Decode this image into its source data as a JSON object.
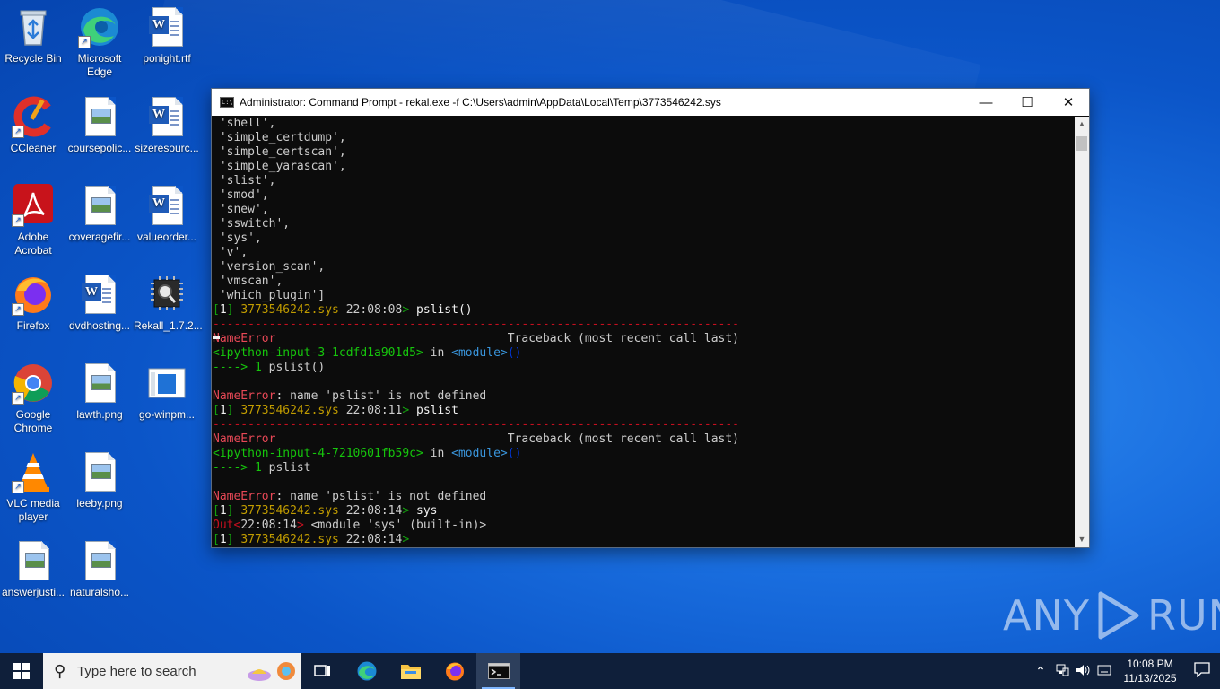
{
  "desktop": {
    "icons": [
      {
        "label": "Recycle Bin",
        "icon": "recycle-bin-icon"
      },
      {
        "label": "Microsoft Edge",
        "icon": "edge-icon"
      },
      {
        "label": "ponight.rtf",
        "icon": "word-document-icon"
      },
      {
        "label": "CCleaner",
        "icon": "ccleaner-icon"
      },
      {
        "label": "coursepolic...",
        "icon": "image-file-icon"
      },
      {
        "label": "sizeresourc...",
        "icon": "word-document-icon"
      },
      {
        "label": "Adobe Acrobat",
        "icon": "acrobat-icon"
      },
      {
        "label": "coveragefir...",
        "icon": "image-file-icon"
      },
      {
        "label": "valueorder...",
        "icon": "word-document-icon"
      },
      {
        "label": "Firefox",
        "icon": "firefox-icon"
      },
      {
        "label": "dvdhosting...",
        "icon": "word-document-icon"
      },
      {
        "label": "Rekall_1.7.2...",
        "icon": "rekall-icon"
      },
      {
        "label": "Google Chrome",
        "icon": "chrome-icon"
      },
      {
        "label": "lawth.png",
        "icon": "image-file-icon"
      },
      {
        "label": "go-winpm...",
        "icon": "app-window-icon"
      },
      {
        "label": "VLC media player",
        "icon": "vlc-icon"
      },
      {
        "label": "leeby.png",
        "icon": "image-file-icon"
      },
      {
        "label": "answerjusti...",
        "icon": "image-file-icon"
      },
      {
        "label": "naturalsho...",
        "icon": "image-file-icon"
      }
    ]
  },
  "window": {
    "title": "Administrator: Command Prompt - rekal.exe  -f C:\\Users\\admin\\AppData\\Local\\Temp\\3773546242.sys",
    "minimize": "—",
    "maximize": "☐",
    "close": "✕"
  },
  "terminal": {
    "lines": [
      [
        {
          "t": " 'shell',",
          "c": "grey"
        }
      ],
      [
        {
          "t": " 'simple_certdump',",
          "c": "grey"
        }
      ],
      [
        {
          "t": " 'simple_certscan',",
          "c": "grey"
        }
      ],
      [
        {
          "t": " 'simple_yarascan',",
          "c": "grey"
        }
      ],
      [
        {
          "t": " 'slist',",
          "c": "grey"
        }
      ],
      [
        {
          "t": " 'smod',",
          "c": "grey"
        }
      ],
      [
        {
          "t": " 'snew',",
          "c": "grey"
        }
      ],
      [
        {
          "t": " 'sswitch',",
          "c": "grey"
        }
      ],
      [
        {
          "t": " 'sys',",
          "c": "grey"
        }
      ],
      [
        {
          "t": " 'v',",
          "c": "grey"
        }
      ],
      [
        {
          "t": " 'version_scan',",
          "c": "grey"
        }
      ],
      [
        {
          "t": " 'vmscan',",
          "c": "grey"
        }
      ],
      [
        {
          "t": " 'which_plugin']",
          "c": "grey"
        }
      ],
      [
        {
          "t": "[",
          "c": "dgreen"
        },
        {
          "t": "1",
          "c": "white"
        },
        {
          "t": "] ",
          "c": "dgreen"
        },
        {
          "t": "3773546242.sys",
          "c": "olive"
        },
        {
          "t": " 22:08:08",
          "c": "grey"
        },
        {
          "t": "> ",
          "c": "dgreen"
        },
        {
          "t": "pslist()",
          "c": "white"
        }
      ],
      [
        {
          "t": "---------------------------------------------------------------------------",
          "c": "dred"
        }
      ],
      [
        {
          "t": "NameError",
          "c": "red"
        },
        {
          "t": "                                 Traceback (most recent call last)",
          "c": "grey"
        }
      ],
      [
        {
          "t": "<ipython-input-3-1cdfd1a901d5>",
          "c": "green"
        },
        {
          "t": " in ",
          "c": "grey"
        },
        {
          "t": "<module>",
          "c": "teal"
        },
        {
          "t": "()",
          "c": "blue"
        }
      ],
      [
        {
          "t": "----> 1 ",
          "c": "green"
        },
        {
          "t": "pslist()",
          "c": "grey"
        }
      ],
      [
        {
          "t": "",
          "c": "grey"
        }
      ],
      [
        {
          "t": "NameError",
          "c": "red"
        },
        {
          "t": ": name 'pslist' is not defined",
          "c": "grey"
        }
      ],
      [
        {
          "t": "[",
          "c": "dgreen"
        },
        {
          "t": "1",
          "c": "white"
        },
        {
          "t": "] ",
          "c": "dgreen"
        },
        {
          "t": "3773546242.sys",
          "c": "olive"
        },
        {
          "t": " 22:08:11",
          "c": "grey"
        },
        {
          "t": "> ",
          "c": "dgreen"
        },
        {
          "t": "pslist",
          "c": "white"
        }
      ],
      [
        {
          "t": "---------------------------------------------------------------------------",
          "c": "dred"
        }
      ],
      [
        {
          "t": "NameError",
          "c": "red"
        },
        {
          "t": "                                 Traceback (most recent call last)",
          "c": "grey"
        }
      ],
      [
        {
          "t": "<ipython-input-4-7210601fb59c>",
          "c": "green"
        },
        {
          "t": " in ",
          "c": "grey"
        },
        {
          "t": "<module>",
          "c": "teal"
        },
        {
          "t": "()",
          "c": "blue"
        }
      ],
      [
        {
          "t": "----> 1 ",
          "c": "green"
        },
        {
          "t": "pslist",
          "c": "grey"
        }
      ],
      [
        {
          "t": "",
          "c": "grey"
        }
      ],
      [
        {
          "t": "NameError",
          "c": "red"
        },
        {
          "t": ": name 'pslist' is not defined",
          "c": "grey"
        }
      ],
      [
        {
          "t": "[",
          "c": "dgreen"
        },
        {
          "t": "1",
          "c": "white"
        },
        {
          "t": "] ",
          "c": "dgreen"
        },
        {
          "t": "3773546242.sys",
          "c": "olive"
        },
        {
          "t": " 22:08:14",
          "c": "grey"
        },
        {
          "t": "> ",
          "c": "dgreen"
        },
        {
          "t": "sys",
          "c": "white"
        }
      ],
      [
        {
          "t": "Out",
          "c": "dred"
        },
        {
          "t": "<",
          "c": "dred"
        },
        {
          "t": "22:08:14",
          "c": "grey"
        },
        {
          "t": "> ",
          "c": "dred"
        },
        {
          "t": "<module 'sys' (built-in)>",
          "c": "grey"
        }
      ],
      [
        {
          "t": "[",
          "c": "dgreen"
        },
        {
          "t": "1",
          "c": "white"
        },
        {
          "t": "] ",
          "c": "dgreen"
        },
        {
          "t": "3773546242.sys",
          "c": "olive"
        },
        {
          "t": " 22:08:14",
          "c": "grey"
        },
        {
          "t": "> ",
          "c": "dgreen"
        }
      ]
    ]
  },
  "watermark": {
    "left": "ANY",
    "right": "RUN"
  },
  "taskbar": {
    "search_placeholder": "Type here to search",
    "apps": [
      {
        "name": "task-view-icon",
        "glyph": "⧉"
      },
      {
        "name": "edge-taskbar-icon",
        "glyph": "◉"
      },
      {
        "name": "file-explorer-icon",
        "glyph": "▬"
      },
      {
        "name": "firefox-taskbar-icon",
        "glyph": "●"
      },
      {
        "name": "command-prompt-taskbar-icon",
        "glyph": "▭"
      }
    ],
    "time": "10:08 PM",
    "date": "11/13/2025"
  },
  "colors": {
    "red": "#e74856",
    "dred": "#c50f1f",
    "green": "#16c60c",
    "dgreen": "#13a10e",
    "olive": "#c19c00",
    "teal": "#3a96dd",
    "blue": "#0037da",
    "white": "#f2f2f2",
    "grey": "#cccccc"
  }
}
